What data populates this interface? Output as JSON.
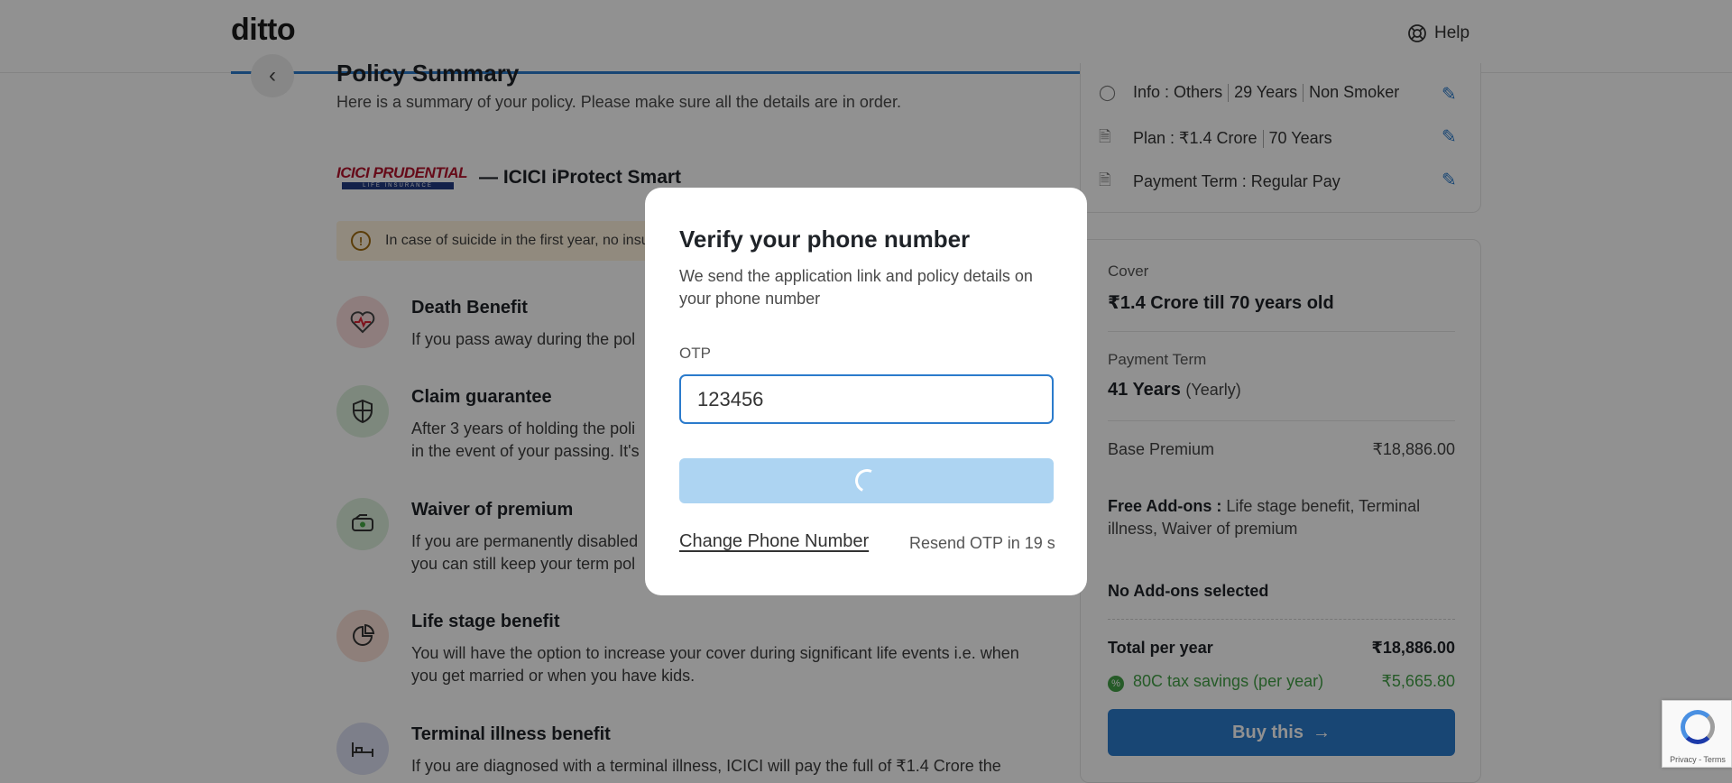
{
  "header": {
    "logo": "ditto",
    "help_label": "Help"
  },
  "page": {
    "title": "Policy Summary",
    "subtitle": "Here is a summary of your policy. Please make sure all the details are in order.",
    "insurer_logo_text": "ICICI PRUDENTIAL",
    "insurer_logo_subtext": "LIFE INSURANCE",
    "product_name": "— ICICI iProtect Smart",
    "warning": "In case of suicide in the first year, no insu"
  },
  "benefits": [
    {
      "title": "Death Benefit",
      "desc": "If you pass away during the pol"
    },
    {
      "title": "Claim guarantee",
      "desc": "After 3 years of holding the poli\nin the event of your passing. It's"
    },
    {
      "title": "Waiver of premium",
      "desc": "If you are permanently disabled\nyou can still keep your term pol"
    },
    {
      "title": "Life stage benefit",
      "desc": "You will have the option to increase your cover during significant life events i.e. when\nyou get married or when you have kids."
    },
    {
      "title": "Terminal illness benefit",
      "desc": "If you are diagnosed with a terminal illness, ICICI will pay the full of ₹1.4 Crore the"
    }
  ],
  "info": {
    "info_label": "Info :",
    "info_values": [
      "Others",
      "29 Years",
      "Non Smoker"
    ],
    "plan_label": "Plan :",
    "plan_values": [
      "₹1.4 Crore",
      "70 Years"
    ],
    "payment_label": "Payment Term :",
    "payment_value": "Regular Pay"
  },
  "summary": {
    "cover_label": "Cover",
    "cover_value": "₹1.4 Crore till 70 years old",
    "payment_term_label": "Payment Term",
    "payment_term_value": "41 Years",
    "payment_term_freq": "(Yearly)",
    "base_premium_label": "Base Premium",
    "base_premium_value": "₹18,886.00",
    "free_addons_label": "Free Add-ons :",
    "free_addons_value": "Life stage benefit, Terminal illness, Waiver of premium",
    "no_addons": "No Add-ons selected",
    "total_label": "Total per year",
    "total_value": "₹18,886.00",
    "tax_label": "80C tax savings (per year)",
    "tax_value": "₹5,665.80",
    "buy_label": "Buy this"
  },
  "modal": {
    "title": "Verify your phone number",
    "description": "We send the application link and policy details on your phone number",
    "otp_label": "OTP",
    "otp_value": "123456",
    "change_phone": "Change Phone Number",
    "resend": "Resend OTP in 19 s"
  },
  "recaptcha": {
    "text": "Privacy - Terms"
  },
  "colors": {
    "accent": "#2b7bcc",
    "overlay": "rgba(0,0,0,0.43)",
    "button_loading": "#add4f2",
    "success": "#43a047"
  }
}
